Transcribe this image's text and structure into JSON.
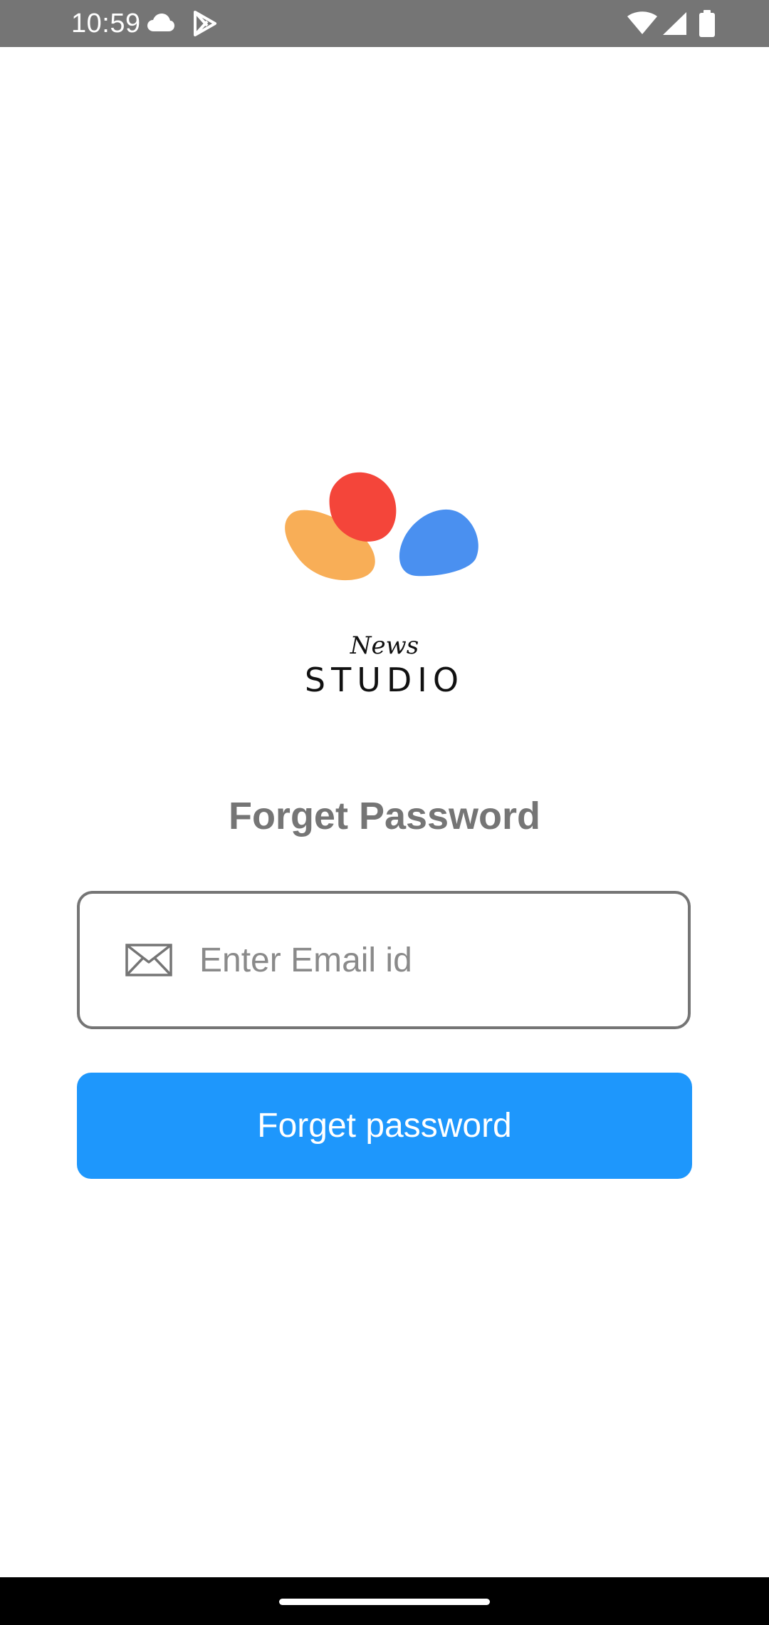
{
  "status_bar": {
    "time": "10:59",
    "icons": [
      "cloud-icon",
      "play-store-icon",
      "wifi-icon",
      "signal-icon",
      "battery-icon"
    ]
  },
  "logo": {
    "script_text": "News",
    "wordmark": "STUDIO",
    "colors": {
      "red": "#f4453a",
      "orange": "#f8ae57",
      "blue": "#4a90f0"
    }
  },
  "page": {
    "title": "Forget Password"
  },
  "email_field": {
    "icon": "mail-icon",
    "value": "",
    "placeholder": "Enter Email id"
  },
  "submit_button": {
    "label": "Forget password",
    "color": "#1e97fc"
  },
  "nav_bar": {
    "handle": "home-handle"
  }
}
